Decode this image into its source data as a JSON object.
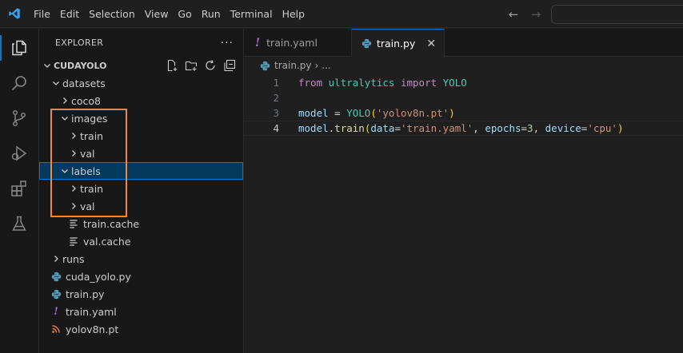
{
  "menu": [
    "File",
    "Edit",
    "Selection",
    "View",
    "Go",
    "Run",
    "Terminal",
    "Help"
  ],
  "sidebar": {
    "title": "EXPLORER",
    "more": "···",
    "root": "CUDAYOLO",
    "tree": [
      {
        "label": "datasets",
        "depth": 1,
        "kind": "folder-open"
      },
      {
        "label": "coco8",
        "depth": 2,
        "kind": "folder-closed"
      },
      {
        "label": "images",
        "depth": 2,
        "kind": "folder-open"
      },
      {
        "label": "train",
        "depth": 3,
        "kind": "folder-closed"
      },
      {
        "label": "val",
        "depth": 3,
        "kind": "folder-closed"
      },
      {
        "label": "labels",
        "depth": 2,
        "kind": "folder-open",
        "selected": true
      },
      {
        "label": "train",
        "depth": 3,
        "kind": "folder-closed"
      },
      {
        "label": "val",
        "depth": 3,
        "kind": "folder-closed"
      },
      {
        "label": "train.cache",
        "depth": 3,
        "kind": "file-lines"
      },
      {
        "label": "val.cache",
        "depth": 3,
        "kind": "file-lines"
      },
      {
        "label": "runs",
        "depth": 1,
        "kind": "folder-closed"
      },
      {
        "label": "cuda_yolo.py",
        "depth": 1,
        "kind": "file-python"
      },
      {
        "label": "train.py",
        "depth": 1,
        "kind": "file-python"
      },
      {
        "label": "train.yaml",
        "depth": 1,
        "kind": "file-yaml"
      },
      {
        "label": "yolov8n.pt",
        "depth": 1,
        "kind": "file-rss"
      }
    ]
  },
  "tabs": [
    {
      "label": "train.yaml",
      "icon": "yaml-icon",
      "active": false
    },
    {
      "label": "train.py",
      "icon": "python-icon",
      "active": true,
      "close": "✕"
    }
  ],
  "breadcrumb": {
    "file": "train.py",
    "sep": "›",
    "rest": "..."
  },
  "code": [
    {
      "n": "1",
      "text": "from ultralytics import YOLO"
    },
    {
      "n": "2",
      "text": ""
    },
    {
      "n": "3",
      "text": "model = YOLO('yolov8n.pt')"
    },
    {
      "n": "4",
      "text": "model.train(data='train.yaml', epochs=3, device='cpu')",
      "current": true
    }
  ],
  "colors": {
    "accent": "#0078d4",
    "highlight_box": "#f0883e",
    "python_icon": "#519aba",
    "yaml_icon": "#a074c4",
    "rss_icon": "#e37933"
  }
}
